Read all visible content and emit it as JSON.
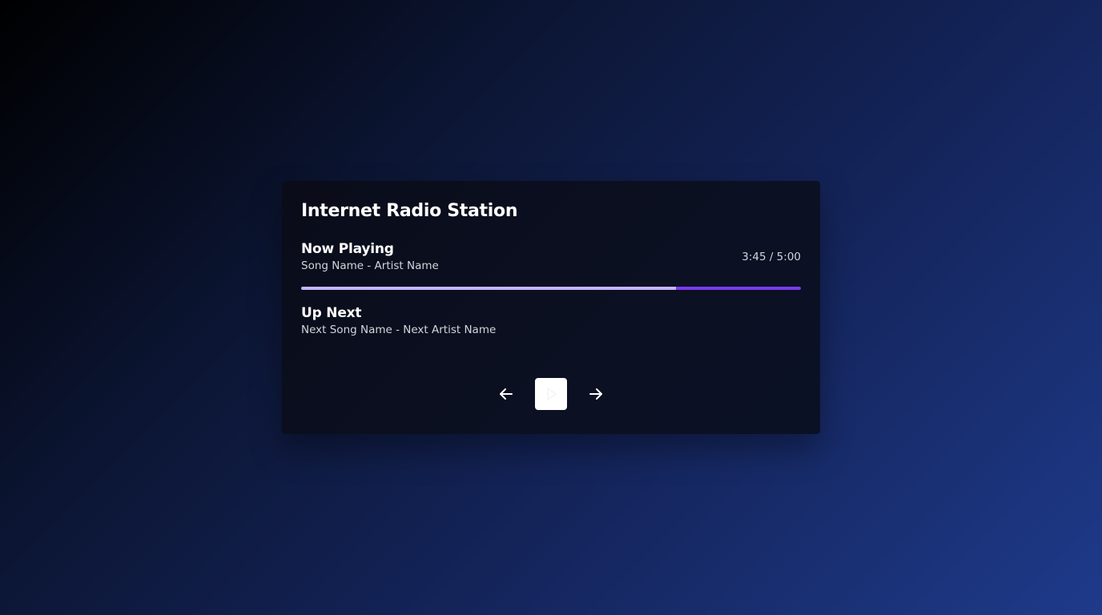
{
  "station": {
    "title": "Internet Radio Station"
  },
  "now_playing": {
    "heading": "Now Playing",
    "track": "Song Name - Artist Name",
    "time": "3:45 / 5:00",
    "progress": 0.75
  },
  "up_next": {
    "heading": "Up Next",
    "track": "Next Song Name - Next Artist Name"
  },
  "controls": {
    "previous_icon": "arrow-left-icon",
    "play_icon": "play-icon",
    "next_icon": "arrow-right-icon"
  },
  "colors": {
    "progress_played": "#c4b5fd",
    "progress_track": "#7c3aed",
    "card_background": "#0a0c19"
  }
}
